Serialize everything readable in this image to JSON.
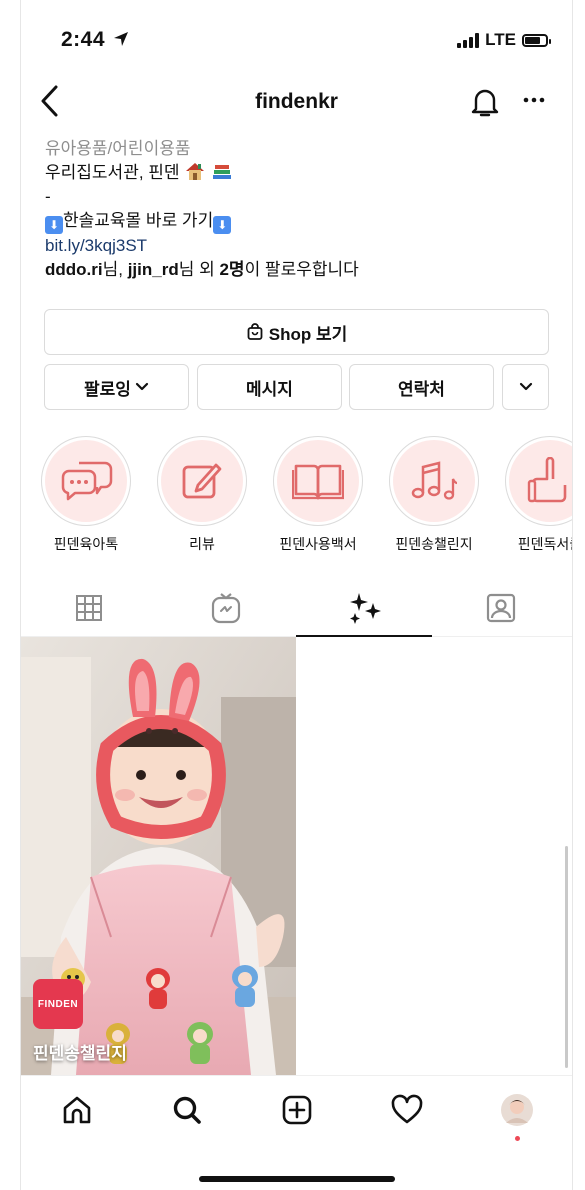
{
  "status": {
    "time": "2:44",
    "network": "LTE"
  },
  "nav": {
    "username": "findenkr"
  },
  "bio": {
    "category": "유아용품/어린이용품",
    "line1": "우리집도서관, 핀덴",
    "line2": "-",
    "line3": "한솔교육몰 바로 가기",
    "link": "bit.ly/3kqj3ST",
    "followed_user1": "dddo.ri",
    "followed_sep1": "님, ",
    "followed_user2": "jjin_rd",
    "followed_sep2": "님 외 ",
    "followed_count": "2명",
    "followed_tail": "이 팔로우합니다"
  },
  "buttons": {
    "shop": "Shop 보기",
    "following": "팔로잉",
    "message": "메시지",
    "contact": "연락처"
  },
  "highlights": [
    {
      "label": "핀덴육아톡",
      "icon": "chat-bubbles-icon"
    },
    {
      "label": "리뷰",
      "icon": "edit-icon"
    },
    {
      "label": "핀덴사용백서",
      "icon": "book-icon"
    },
    {
      "label": "핀덴송챌린지",
      "icon": "music-notes-icon"
    },
    {
      "label": "핀덴독서클",
      "icon": "thumbs-up-icon"
    }
  ],
  "post": {
    "brand": "FINDEN",
    "caption": "핀덴송챌린지"
  },
  "colors": {
    "highlight_bg": "#fde9e8",
    "highlight_icon": "#e06a6a",
    "brand_red": "#e4384f",
    "link": "#1b3a6b"
  }
}
